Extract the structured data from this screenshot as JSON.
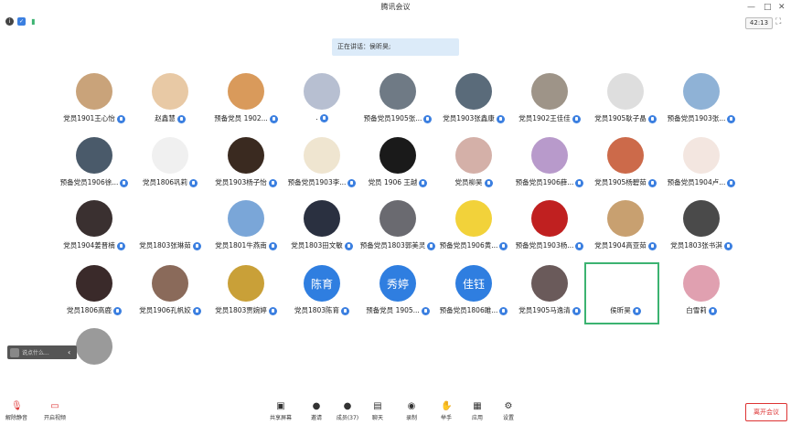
{
  "window": {
    "title": "腾讯会议"
  },
  "status": {
    "timer": "42:13",
    "speaking_label": "正在讲话：侯昕昊;"
  },
  "participants": [
    {
      "name": "党员1901王心怡",
      "text": ""
    },
    {
      "name": "赵鑫慧",
      "text": ""
    },
    {
      "name": "预备党员 1902...",
      "text": ""
    },
    {
      "name": ".",
      "text": ""
    },
    {
      "name": "预备党员1905张...",
      "text": ""
    },
    {
      "name": "党员1903张鑫康",
      "text": ""
    },
    {
      "name": "党员1902王佳佳",
      "text": ""
    },
    {
      "name": "党员1905耿子晶",
      "text": ""
    },
    {
      "name": "预备党员1903张...",
      "text": ""
    },
    {
      "name": "预备党员1906徐...",
      "text": ""
    },
    {
      "name": "党员1806巩莉",
      "text": ""
    },
    {
      "name": "党员1903杨子怡",
      "text": ""
    },
    {
      "name": "预备党员1903李...",
      "text": ""
    },
    {
      "name": "党员 1906 王越",
      "text": ""
    },
    {
      "name": "党员柳昊",
      "text": ""
    },
    {
      "name": "预备党员1906薛...",
      "text": ""
    },
    {
      "name": "党员1905杨碧茹",
      "text": ""
    },
    {
      "name": "预备党员1904卢...",
      "text": ""
    },
    {
      "name": "党员1904姜晋楠",
      "text": ""
    },
    {
      "name": "党员1803张琳茹",
      "text": ""
    },
    {
      "name": "党员1801牛燕南",
      "text": ""
    },
    {
      "name": "党员1803田文敏",
      "text": ""
    },
    {
      "name": "预备党员1803郭美灵",
      "text": ""
    },
    {
      "name": "预备党员1906黄...",
      "text": ""
    },
    {
      "name": "预备党员1903杨...",
      "text": ""
    },
    {
      "name": "党员1904高亚茹",
      "text": ""
    },
    {
      "name": "党员1803张书淇",
      "text": ""
    },
    {
      "name": "党员1806高鹿",
      "text": ""
    },
    {
      "name": "党员1906孔帆姣",
      "text": ""
    },
    {
      "name": "党员1803贾婉婷",
      "text": ""
    },
    {
      "name": "党员1803陈育",
      "text": "陈育"
    },
    {
      "name": "预备党员 1905...",
      "text": "秀婷"
    },
    {
      "name": "预备党员1806雎...",
      "text": "佳钰"
    },
    {
      "name": "党员1905马逸清",
      "text": ""
    },
    {
      "name": "侯昕昊",
      "text": ""
    },
    {
      "name": "白雪莉",
      "text": ""
    },
    {
      "name": "",
      "text": ""
    }
  ],
  "chat": {
    "placeholder": "说点什么..."
  },
  "toolbar": {
    "mute": "解除静音",
    "video": "开启视频",
    "share": "共享屏幕",
    "invite": "邀请",
    "members": "成员(37)",
    "chat": "聊天",
    "record": "录制",
    "hand": "举手",
    "apps": "应用",
    "settings": "设置",
    "leave": "离开会议"
  },
  "colors": {
    "accent": "#3b7fe0",
    "highlight": "#3cb371",
    "leave": "#dd3333"
  }
}
